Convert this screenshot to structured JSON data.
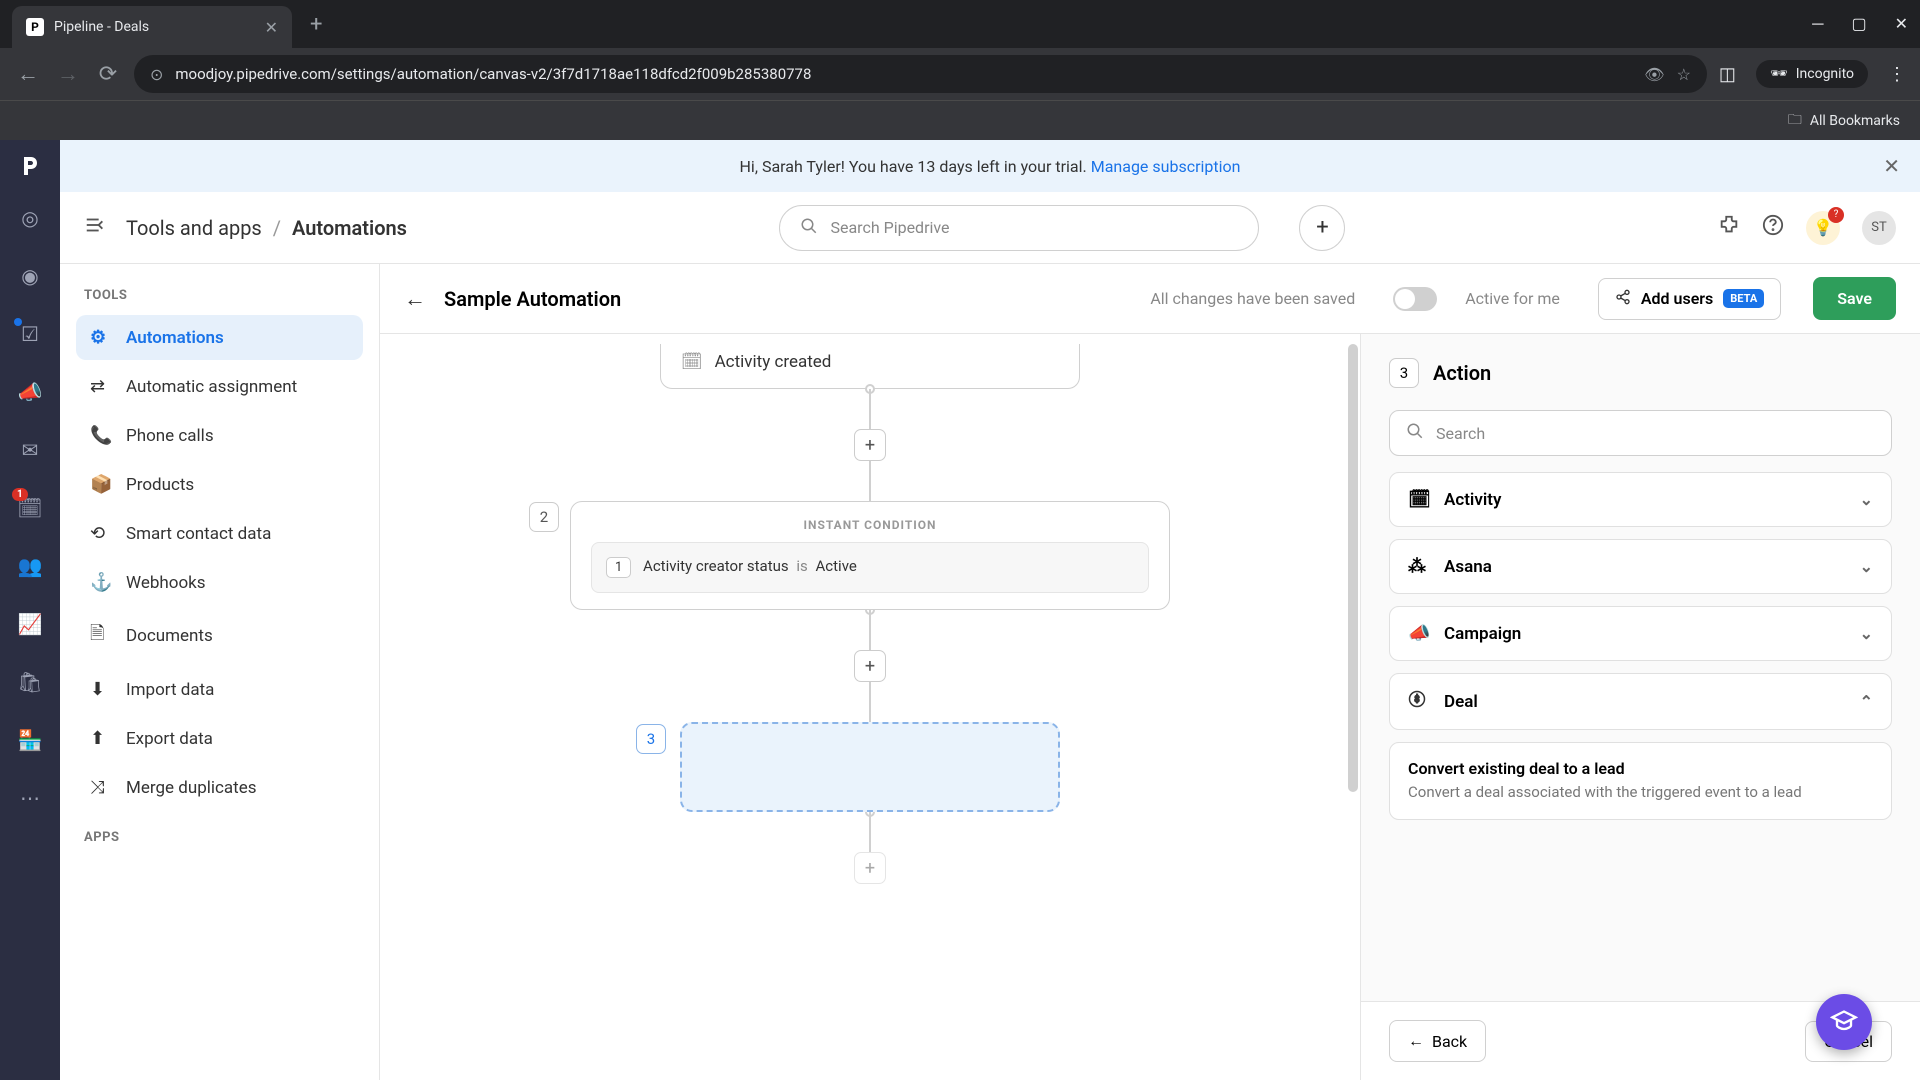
{
  "browser": {
    "tab_title": "Pipeline - Deals",
    "url": "moodjoy.pipedrive.com/settings/automation/canvas-v2/3f7d1718ae118dfcd2f009b285380778",
    "incognito": "Incognito",
    "bookmarks": "All Bookmarks"
  },
  "banner": {
    "text": "Hi, Sarah Tyler! You have 13 days left in your trial.",
    "link": "Manage subscription"
  },
  "header": {
    "crumb1": "Tools and apps",
    "crumb2": "Automations",
    "search_placeholder": "Search Pipedrive",
    "avatar": "ST"
  },
  "sidebar": {
    "heading1": "TOOLS",
    "heading2": "APPS",
    "items": [
      {
        "label": "Automations",
        "active": true
      },
      {
        "label": "Automatic assignment"
      },
      {
        "label": "Phone calls"
      },
      {
        "label": "Products"
      },
      {
        "label": "Smart contact data"
      },
      {
        "label": "Webhooks"
      },
      {
        "label": "Documents"
      },
      {
        "label": "Import data"
      },
      {
        "label": "Export data"
      },
      {
        "label": "Merge duplicates"
      }
    ]
  },
  "canvas_header": {
    "title": "Sample Automation",
    "saved": "All changes have been saved",
    "toggle_label": "Active for me",
    "add_users": "Add users",
    "beta": "BETA",
    "save": "Save"
  },
  "canvas": {
    "node1_text": "Activity created",
    "node2": {
      "num": "2",
      "label": "INSTANT CONDITION",
      "chip": "1",
      "field": "Activity creator status",
      "op": "is",
      "value": "Active"
    },
    "node3_num": "3"
  },
  "panel": {
    "step_num": "3",
    "title": "Action",
    "search_placeholder": "Search",
    "categories": [
      {
        "icon": "calendar",
        "label": "Activity"
      },
      {
        "icon": "asana",
        "label": "Asana"
      },
      {
        "icon": "megaphone",
        "label": "Campaign"
      },
      {
        "icon": "dollar",
        "label": "Deal",
        "expanded": true
      }
    ],
    "deal_sub": {
      "title": "Convert existing deal to a lead",
      "desc": "Convert a deal associated with the triggered event to a lead"
    },
    "back": "Back",
    "cancel": "Cancel"
  }
}
